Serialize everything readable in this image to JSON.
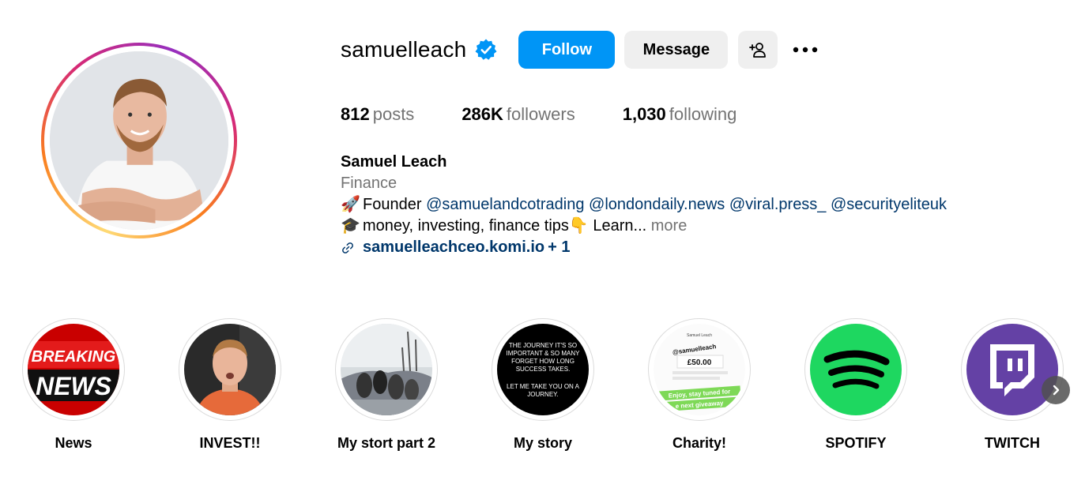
{
  "profile": {
    "username": "samuelleach",
    "verified": true,
    "follow_label": "Follow",
    "message_label": "Message",
    "add_user_icon": "add-person-icon",
    "more_icon": "ellipsis-icon"
  },
  "stats": {
    "posts_count": "812",
    "posts_label": "posts",
    "followers_count": "286K",
    "followers_label": "followers",
    "following_count": "1,030",
    "following_label": "following"
  },
  "bio": {
    "name": "Samuel Leach",
    "category": "Finance",
    "line1_emoji": "🚀",
    "line1_text": "Founder",
    "mentions": [
      "@samuelandcotrading",
      "@londondaily.news",
      "@viral.press_",
      "@securityeliteuk"
    ],
    "line2_emoji": "🎓",
    "line2_text": "money, investing, finance tips",
    "line2_emoji2": "👇",
    "line2_tail": " Learn...",
    "more_label": "more",
    "link_text": "samuelleachceo.komi.io",
    "link_extra": " + 1"
  },
  "highlights": [
    {
      "label": "News",
      "thumb_text_1": "BREAKING",
      "thumb_text_2": "NEWS"
    },
    {
      "label": "INVEST!!"
    },
    {
      "label": "My stort part 2"
    },
    {
      "label": "My story",
      "thumb_lines": [
        "THE JOURNEY IT'S SO",
        "IMPORTANT & SO MANY",
        "FORGET HOW LONG",
        "SUCCESS TAKES.",
        "",
        "LET ME TAKE YOU ON A",
        "JOURNEY."
      ]
    },
    {
      "label": "Charity!",
      "thumb_header": "Samuel Leach",
      "thumb_mention": "@samuelleach",
      "thumb_amount": "£50.00",
      "thumb_banner_1": "Enjoy, stay tuned for",
      "thumb_banner_2": "e next giveaway"
    },
    {
      "label": "SPOTIFY"
    },
    {
      "label": "TWITCH"
    }
  ],
  "colors": {
    "follow_blue": "#0095f6",
    "mention_blue": "#00376b",
    "secondary_text": "#737373",
    "button_grey": "#efefef",
    "spotify_green": "#1ed760",
    "twitch_purple": "#6441a5"
  }
}
